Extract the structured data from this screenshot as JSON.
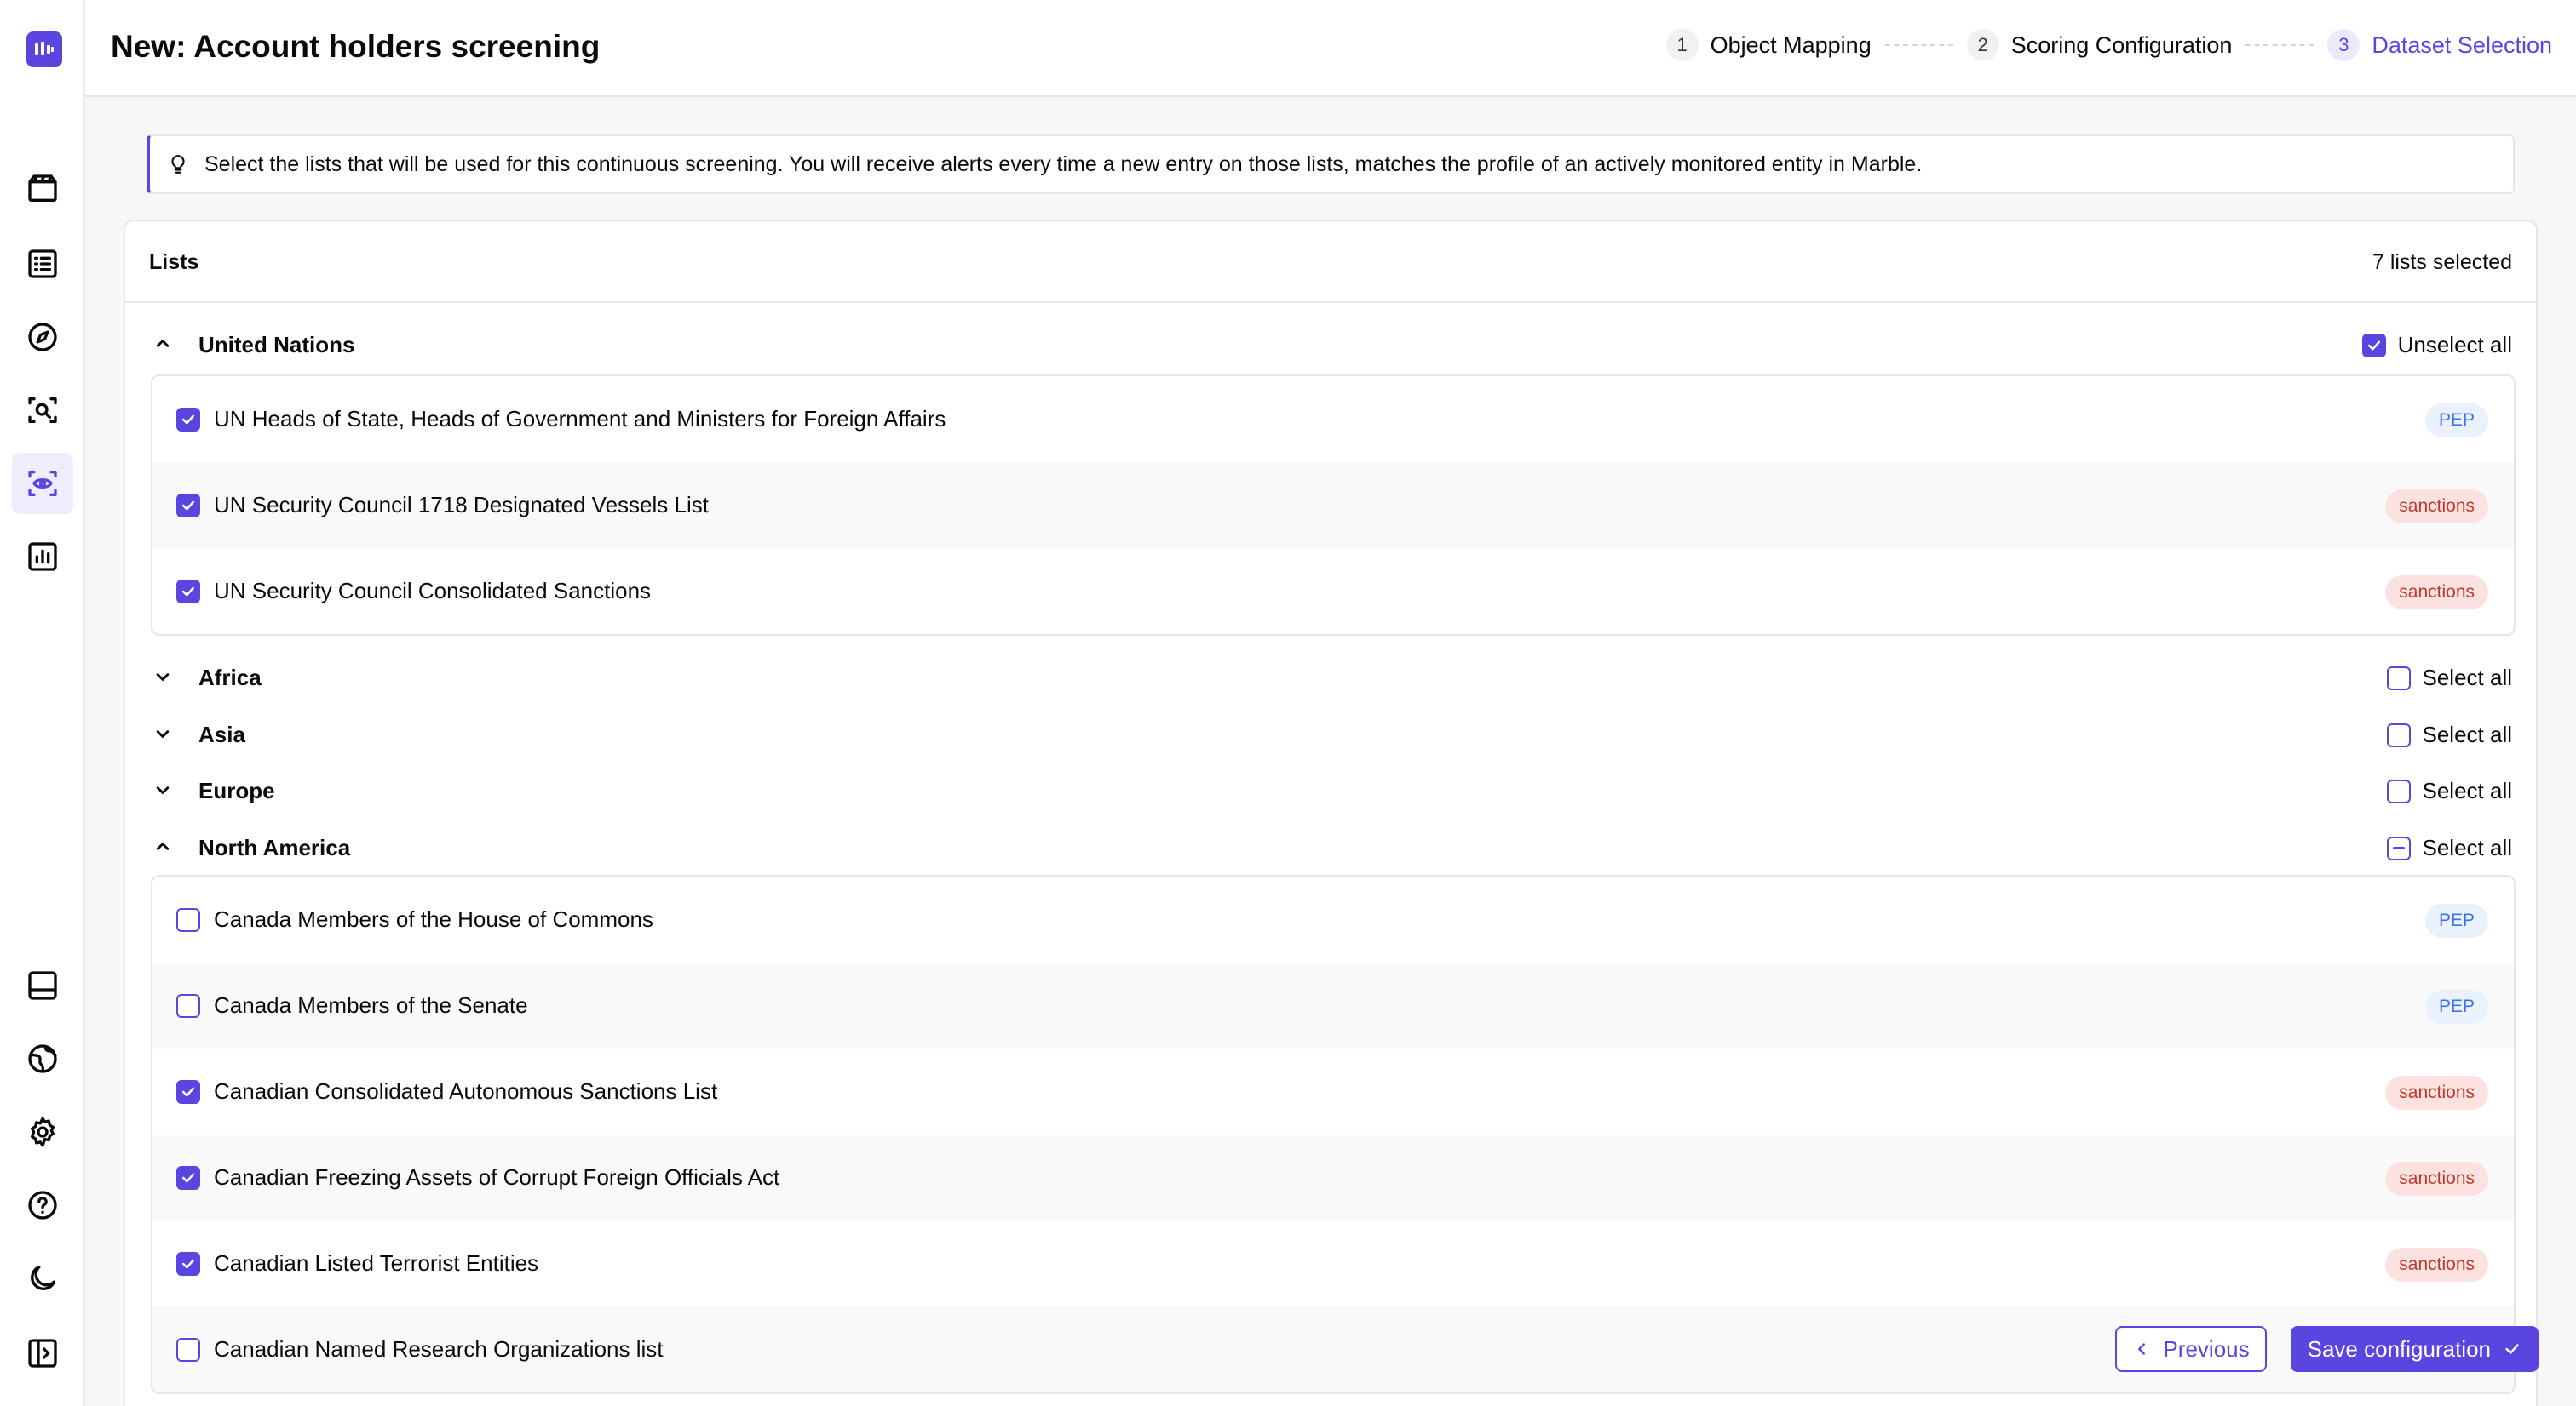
{
  "header": {
    "title": "New: Account holders screening",
    "steps": [
      {
        "num": "1",
        "label": "Object Mapping"
      },
      {
        "num": "2",
        "label": "Scoring Configuration"
      },
      {
        "num": "3",
        "label": "Dataset Selection"
      }
    ]
  },
  "banner": {
    "text": "Select the lists that will be used for this continuous screening. You will receive alerts every time a new entry on those lists, matches the profile of an actively monitored entity in Marble."
  },
  "lists": {
    "title": "Lists",
    "selected_count": "7 lists selected"
  },
  "groups": [
    {
      "name": "United Nations",
      "expanded": true,
      "action": "Unselect all",
      "state": "checked",
      "items": [
        {
          "label": "UN Heads of State, Heads of Government and Ministers for Foreign Affairs",
          "checked": true,
          "tag": "PEP"
        },
        {
          "label": "UN Security Council 1718 Designated Vessels List",
          "checked": true,
          "tag": "sanctions"
        },
        {
          "label": "UN Security Council Consolidated Sanctions",
          "checked": true,
          "tag": "sanctions"
        }
      ]
    },
    {
      "name": "Africa",
      "expanded": false,
      "action": "Select all",
      "state": "unchecked"
    },
    {
      "name": "Asia",
      "expanded": false,
      "action": "Select all",
      "state": "unchecked"
    },
    {
      "name": "Europe",
      "expanded": false,
      "action": "Select all",
      "state": "unchecked"
    },
    {
      "name": "North America",
      "expanded": true,
      "action": "Select all",
      "state": "partial",
      "items": [
        {
          "label": "Canada Members of the House of Commons",
          "checked": false,
          "tag": "PEP"
        },
        {
          "label": "Canada Members of the Senate",
          "checked": false,
          "tag": "PEP"
        },
        {
          "label": "Canadian Consolidated Autonomous Sanctions List",
          "checked": true,
          "tag": "sanctions"
        },
        {
          "label": "Canadian Freezing Assets of Corrupt Foreign Officials Act",
          "checked": true,
          "tag": "sanctions"
        },
        {
          "label": "Canadian Listed Terrorist Entities",
          "checked": true,
          "tag": "sanctions"
        },
        {
          "label": "Canadian Named Research Organizations list",
          "checked": false,
          "tag": ""
        }
      ]
    }
  ],
  "actions": {
    "previous": "Previous",
    "save": "Save configuration"
  },
  "colors": {
    "accent": "#5b45e0",
    "pep_bg": "#eaf1fd",
    "pep_text": "#3b74e6",
    "sanctions_bg": "#fbe2e0",
    "sanctions_text": "#c0382b"
  },
  "icons": {
    "sidebar_top": [
      "clapperboard-icon",
      "list-icon",
      "compass-icon",
      "scan-search-icon",
      "scan-eye-icon",
      "bar-chart-icon"
    ],
    "sidebar_bottom": [
      "inbox-panel-icon",
      "globe-icon",
      "gear-icon",
      "help-circle-icon",
      "moon-icon",
      "sidebar-toggle-icon"
    ]
  }
}
